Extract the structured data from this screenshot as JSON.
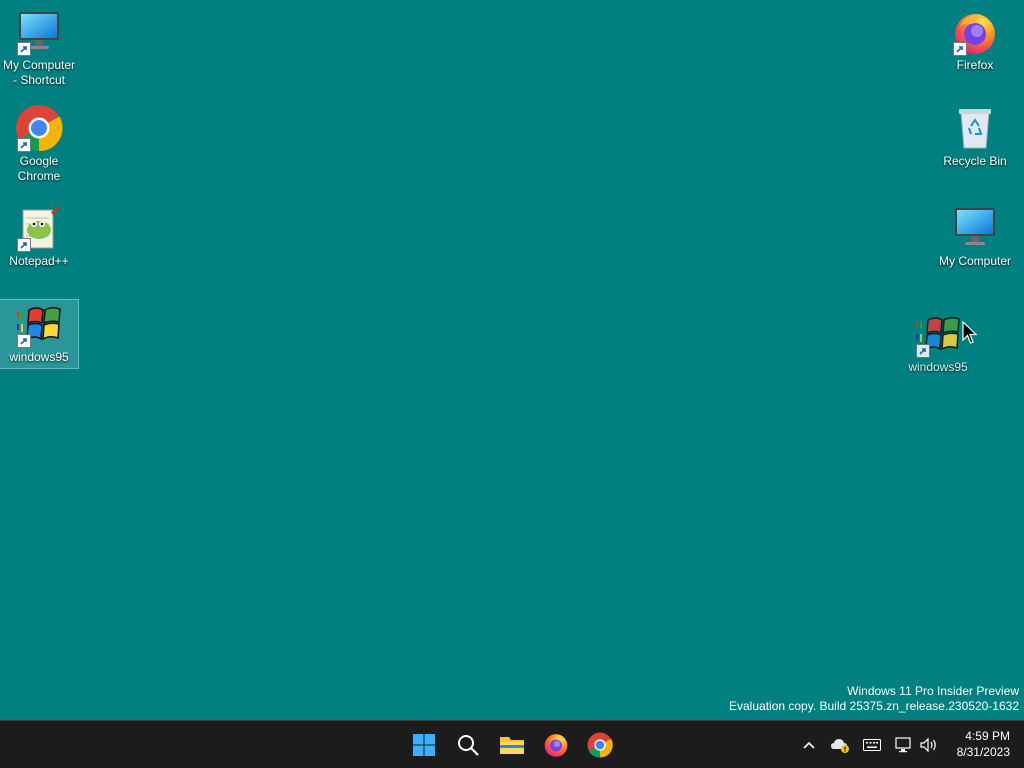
{
  "desktop": {
    "background": "#008080",
    "icons_left": [
      {
        "label": "My Computer - Shortcut",
        "icon": "monitor-icon",
        "shortcut": true
      },
      {
        "label": "Google Chrome",
        "icon": "chrome-icon",
        "shortcut": true
      },
      {
        "label": "Notepad++",
        "icon": "notepadpp-icon",
        "shortcut": true
      },
      {
        "label": "windows95",
        "icon": "windows95-logo-icon",
        "shortcut": true,
        "selected": true
      }
    ],
    "icons_right": [
      {
        "label": "Firefox",
        "icon": "firefox-icon",
        "shortcut": true
      },
      {
        "label": "Recycle Bin",
        "icon": "recycle-bin-icon"
      },
      {
        "label": "My Computer",
        "icon": "monitor-icon"
      }
    ],
    "dragged_icon": {
      "label": "windows95",
      "icon": "windows95-logo-icon",
      "shortcut": true
    }
  },
  "watermark": {
    "line1": "Windows 11 Pro Insider Preview",
    "line2": "Evaluation copy. Build 25375.zn_release.230520-1632"
  },
  "taskbar": {
    "background": "#1c1c1c",
    "pinned": [
      "start-icon",
      "search-icon",
      "file-explorer-icon",
      "firefox-icon",
      "chrome-icon"
    ],
    "tray": [
      "chevron-up-icon",
      "onedrive-warning-icon",
      "keyboard-icon",
      "network-icon",
      "volume-icon"
    ],
    "clock": {
      "time": "4:59 PM",
      "date": "8/31/2023"
    }
  }
}
